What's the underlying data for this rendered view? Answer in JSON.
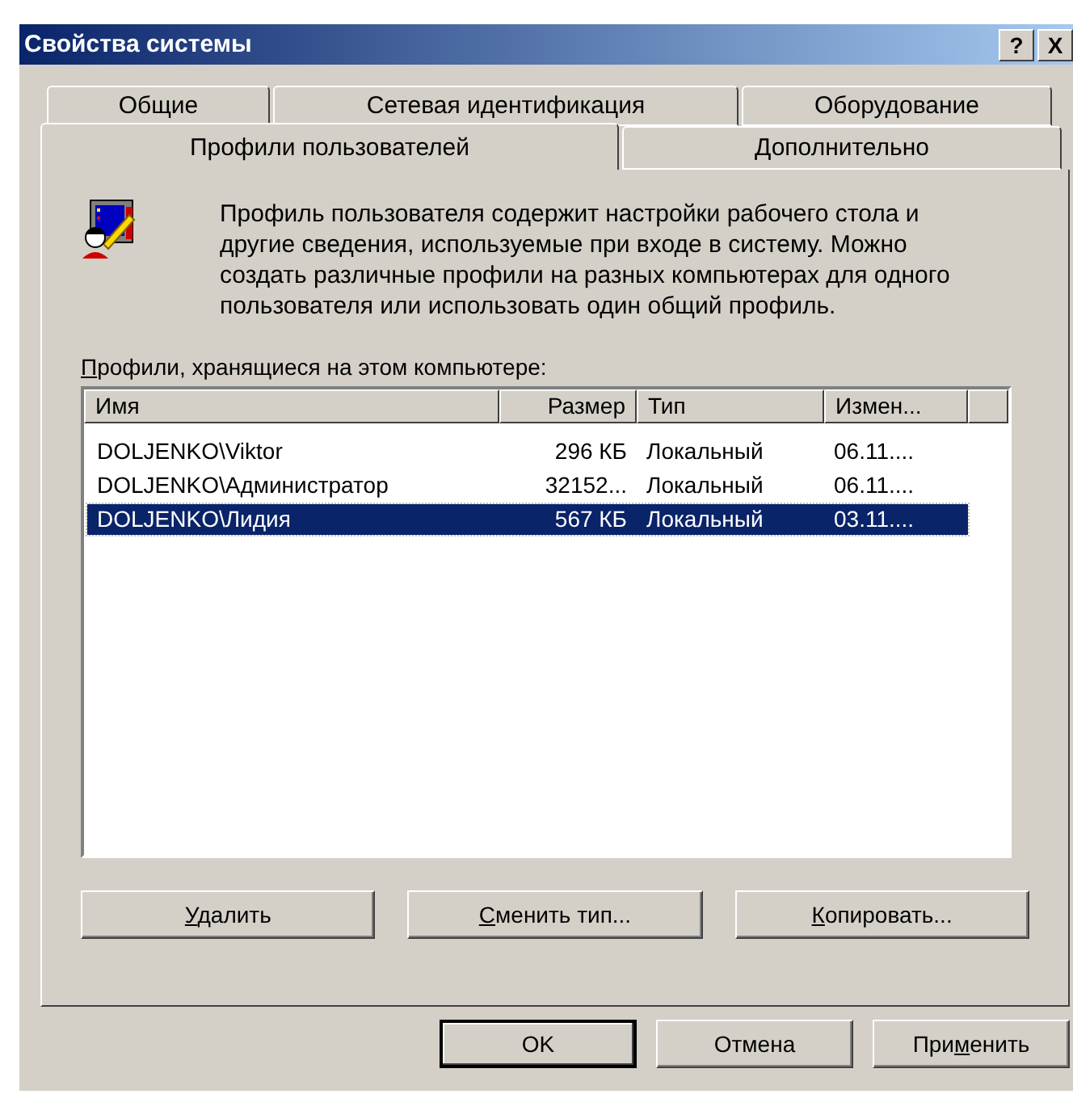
{
  "window": {
    "title": "Свойства системы",
    "help_button": "?",
    "close_button": "X"
  },
  "tab_rows": [
    [
      {
        "label": "Общие",
        "selected": false
      },
      {
        "label": "Сетевая идентификация",
        "selected": false
      },
      {
        "label": "Оборудование",
        "selected": false
      }
    ],
    [
      {
        "label": "Профили пользователей",
        "selected": true
      },
      {
        "label": "Дополнительно",
        "selected": false
      }
    ]
  ],
  "description": "Профиль пользователя содержит настройки рабочего стола и другие сведения, используемые при входе в систему. Можно создать различные профили на разных компьютерах для одного пользователя или использовать один общий профиль.",
  "list_label": {
    "key": "П",
    "post": "рофили, хранящиеся на этом компьютере:"
  },
  "table": {
    "columns": [
      "Имя",
      "Размер",
      "Тип",
      "Измен..."
    ],
    "rows": [
      {
        "cells": [
          "DOLJENKO\\Viktor",
          "296 КБ",
          "Локальный",
          "06.11...."
        ],
        "selected": false
      },
      {
        "cells": [
          "DOLJENKO\\Администратор",
          "32152...",
          "Локальный",
          "06.11...."
        ],
        "selected": false
      },
      {
        "cells": [
          "DOLJENKO\\Лидия",
          "567 КБ",
          "Локальный",
          "03.11...."
        ],
        "selected": true
      }
    ]
  },
  "profile_buttons": [
    {
      "key": "У",
      "post": "далить"
    },
    {
      "key": "С",
      "post": "менить тип..."
    },
    {
      "key": "К",
      "post": "опировать..."
    }
  ],
  "dialog_buttons": [
    {
      "pre": "OK",
      "default": true
    },
    {
      "pre": "Отмена",
      "default": false
    },
    {
      "pre": "При",
      "key": "м",
      "post": "енить",
      "default": false
    }
  ]
}
